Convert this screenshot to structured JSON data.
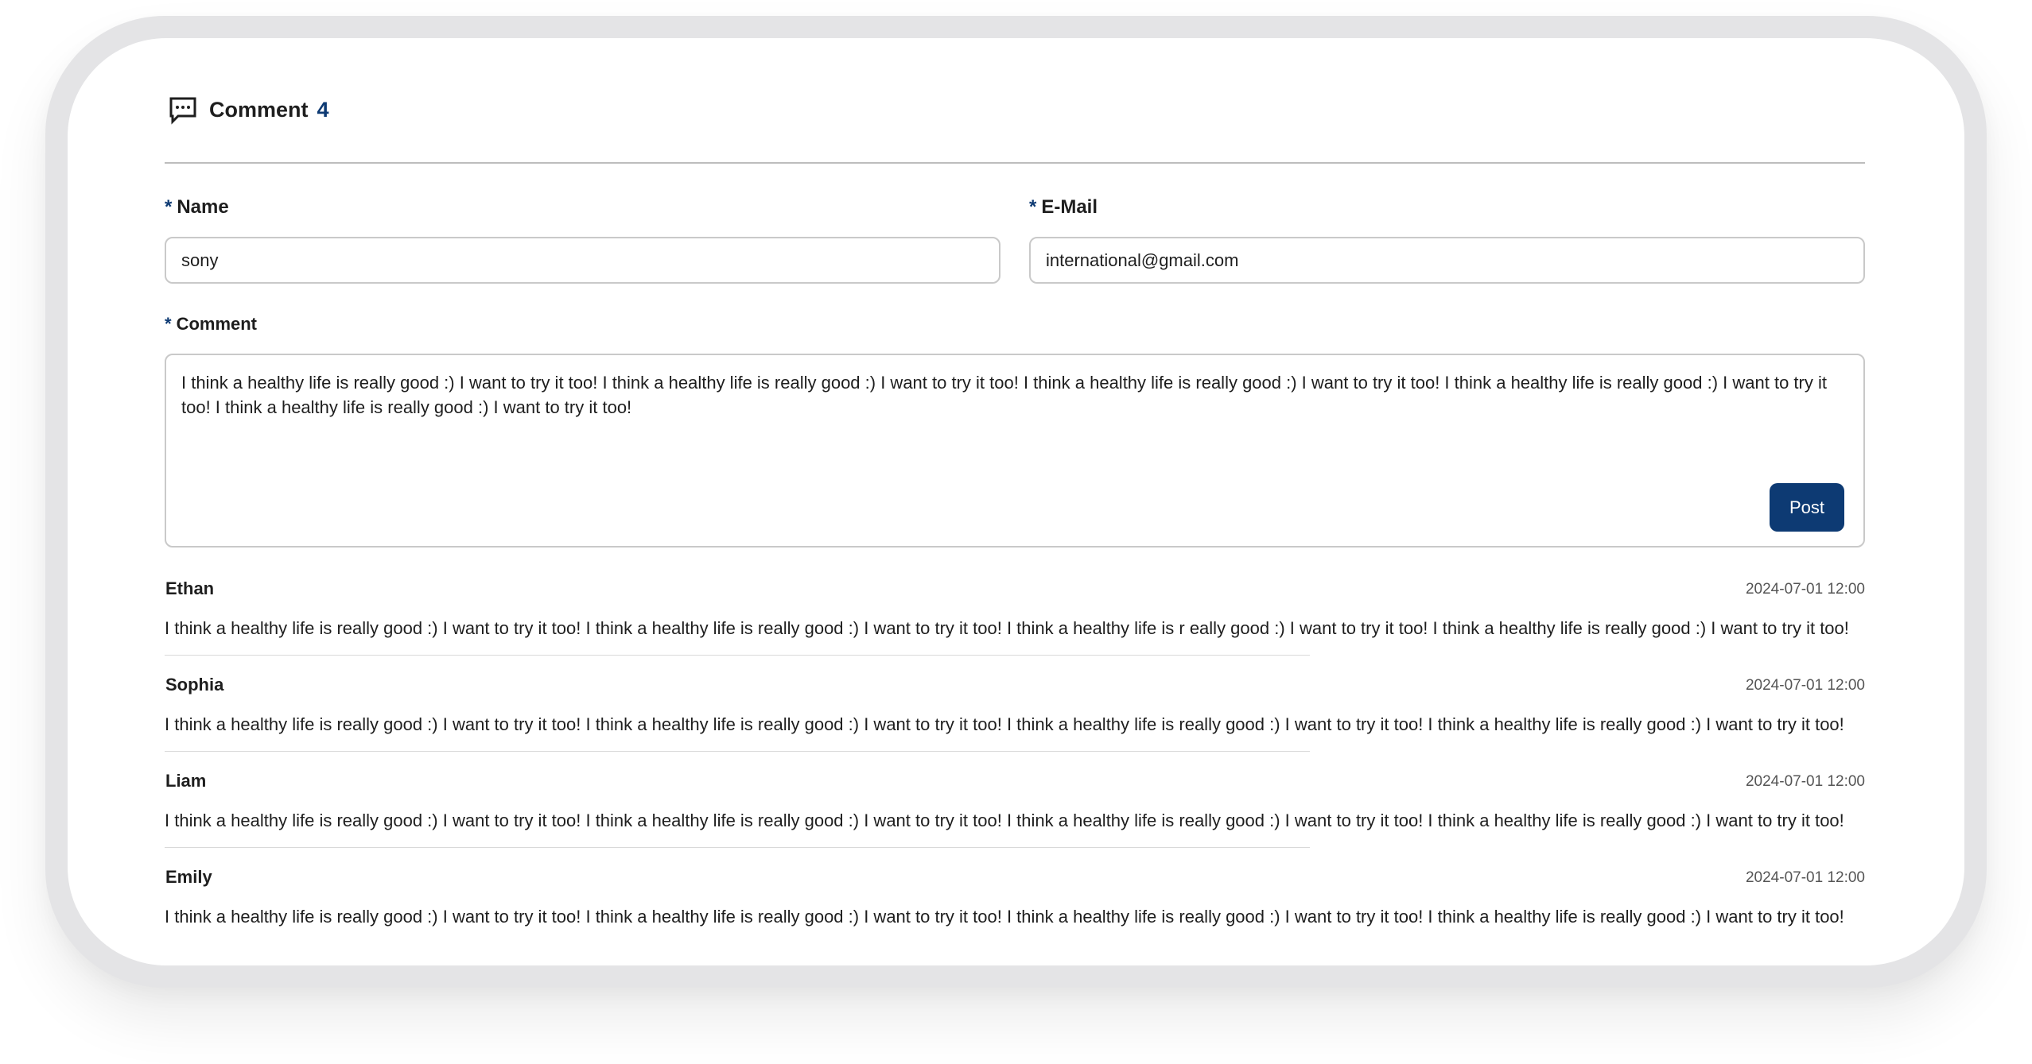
{
  "header": {
    "icon": "chat-bubble-icon",
    "title": "Comment",
    "count": "4"
  },
  "form": {
    "name": {
      "required_mark": "*",
      "label": "Name",
      "value": "sony"
    },
    "email": {
      "required_mark": "*",
      "label": "E-Mail",
      "value": "international@gmail.com"
    },
    "comment": {
      "required_mark": "*",
      "label": "Comment",
      "value": "I think a healthy life is really good :) I want to try it too! I think a healthy life is really good :) I want to try it too! I think a healthy life is really good :) I want to try it too! I think a healthy life is really good :) I want to try it too! I think a healthy life is really good :) I want to try it too!"
    },
    "post_label": "Post"
  },
  "comments": [
    {
      "author": "Ethan",
      "date": "2024-07-01 12:00",
      "text": "I think a healthy life is really good :) I want to try it too! I think a healthy life is really good :) I want to try it too! I think a healthy life is r eally good :) I want to try it too! I think a healthy life is really good :) I want to try it too!"
    },
    {
      "author": "Sophia",
      "date": "2024-07-01 12:00",
      "text": "I think a healthy life is really good :) I want to try it too! I think a healthy life is really good :) I want to try it too! I think a healthy life is really good :) I want to try it too! I think a healthy life is really good :) I want to try it too!"
    },
    {
      "author": "Liam",
      "date": "2024-07-01 12:00",
      "text": "I think a healthy life is really good :) I want to try it too! I think a healthy life is really good :) I want to try it too! I think a healthy life is really good :) I want to try it too! I think a healthy life is really good :) I want to try it too!"
    },
    {
      "author": "Emily",
      "date": "2024-07-01 12:00",
      "text": "I think a healthy life is really good :) I want to try it too! I think a healthy life is really good :) I want to try it too! I think a healthy life is really good :) I want to try it too! I think a healthy life is really good :) I want to try it too!"
    }
  ],
  "colors": {
    "accent": "#0d3a73",
    "frame": "#e4e4e6",
    "border": "#c9c9c9"
  }
}
